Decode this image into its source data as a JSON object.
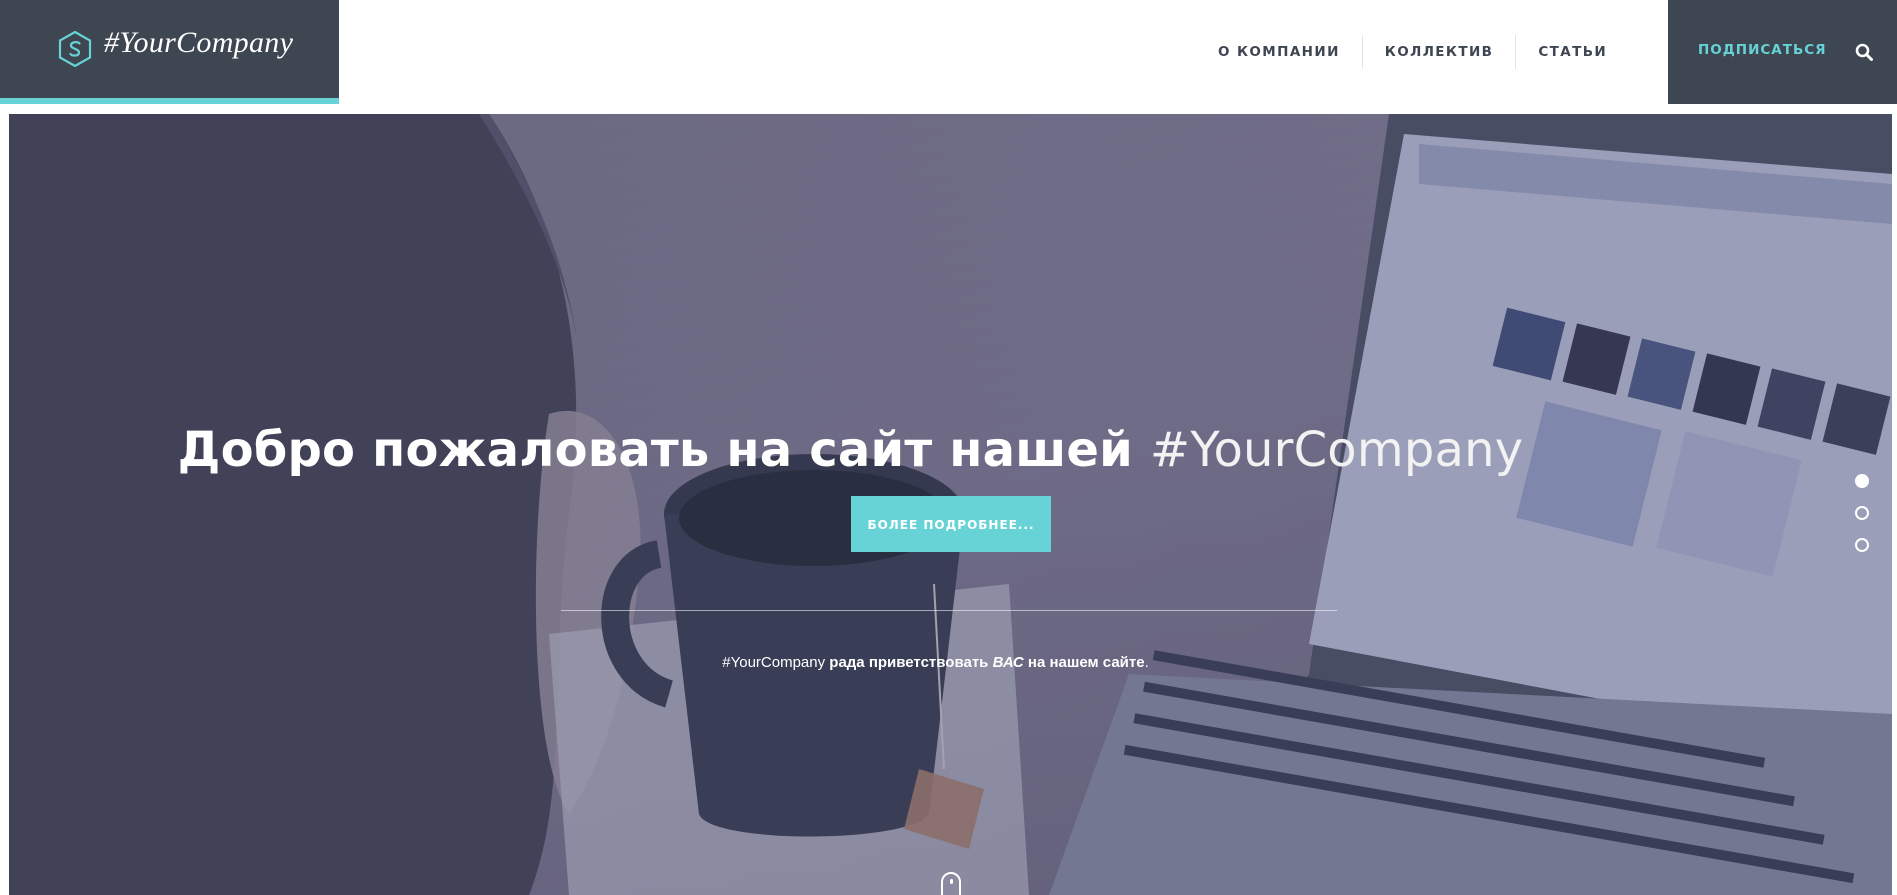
{
  "header": {
    "logo_text": "#YourCompany",
    "nav": [
      {
        "label": "О КОМПАНИИ"
      },
      {
        "label": "КОЛЛЕКТИВ"
      },
      {
        "label": "СТАТЬИ"
      }
    ],
    "subscribe_label": "ПОДПИСАТЬСЯ"
  },
  "hero": {
    "title_main": "Добро пожаловать на сайт нашей ",
    "title_brand": "#YourCompany",
    "cta_label": "БОЛЕЕ ПОДРОБНЕЕ...",
    "subtitle": {
      "brand": "#YourCompany",
      "text1": " рада приветствовать ",
      "emph": "ВАС",
      "text2": " на нашем сайте",
      "end": "."
    },
    "slides": [
      {
        "active": true
      },
      {
        "active": false
      },
      {
        "active": false
      }
    ]
  },
  "colors": {
    "dark": "#3e4651",
    "accent": "#67d3d7",
    "white": "#ffffff"
  },
  "icons": {
    "logo": "hexagon-s-logo-icon",
    "search": "search-icon",
    "scroll": "mouse-scroll-icon"
  }
}
